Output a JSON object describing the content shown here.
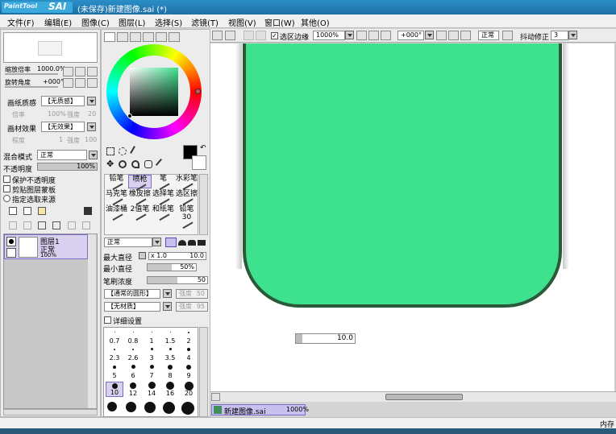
{
  "window": {
    "logo_text": "PaintTool",
    "logo_sai": "SAI",
    "title": "(未保存)新建图像.sai (*)"
  },
  "menu": [
    "文件(F)",
    "编辑(E)",
    "图像(C)",
    "图层(L)",
    "选择(S)",
    "滤镜(T)",
    "视图(V)",
    "窗口(W)",
    "其他(O)"
  ],
  "navigator": {
    "zoom_label": "缩放倍率",
    "zoom_value": "1000.0%",
    "rotate_label": "旋转角度",
    "rotate_value": "+000°"
  },
  "texture": {
    "paper_label": "画纸质感",
    "paper_value": "【无质感】",
    "rate_label": "倍率",
    "rate_value": "100%",
    "strength_label": "强度",
    "strength_value": "20",
    "effect_label": "画材效果",
    "effect_value": "【无效果】",
    "degree_label": "程度",
    "degree_value": "1",
    "effect_strength_label": "强度",
    "effect_strength_value": "100"
  },
  "layer_props": {
    "blend_label": "混合模式",
    "blend_value": "正常",
    "opacity_label": "不透明度",
    "opacity_value": "100%",
    "opacity_fraction": 1.0,
    "preserve_label": "保护不透明度",
    "clip_label": "剪贴图层蒙板",
    "source_label": "指定选取来源"
  },
  "layer": {
    "name": "图层1",
    "mode": "正常",
    "opacity": "100%"
  },
  "color": {
    "current": "#000000",
    "secondary": "#ffffff"
  },
  "tools": [
    "铅笔",
    "喷枪",
    "笔",
    "水彩笔",
    "马克笔",
    "橡皮擦",
    "选择笔",
    "选区擦",
    "油漆桶",
    "2值笔",
    "和纸笔",
    "铅笔30"
  ],
  "brush": {
    "mode_value": "正常",
    "max_size_label": "最大直径",
    "max_size_mult": "x 1.0",
    "max_size_value": "10.0",
    "min_size_label": "最小直径",
    "min_size_value": "50%",
    "min_size_fraction": 0.5,
    "density_label": "笔刷浓度",
    "density_value": "50",
    "density_fraction": 0.5,
    "shape_value": "【通常的圆形】",
    "shape_strength_label": "强度",
    "shape_strength_value": "50",
    "texture_value": "【无材质】",
    "texture_strength_label": "强度",
    "texture_strength_value": "95",
    "detail_label": "详细设置"
  },
  "brush_sizes": [
    "0.7",
    "0.8",
    "1",
    "1.5",
    "2",
    "2.3",
    "2.6",
    "3",
    "3.5",
    "4",
    "5",
    "6",
    "7",
    "8",
    "9",
    "10",
    "12",
    "14",
    "16",
    "20"
  ],
  "canvas_toolbar": {
    "selection_edge_label": "选区边缘",
    "zoom_value": "1000%",
    "rotate_value": "+000°",
    "mode_value": "正常",
    "stabilizer_label": "抖动修正",
    "stabilizer_value": "3"
  },
  "canvas": {
    "fill_color": "#3ee28e",
    "edge_color": "#2a5a3a",
    "bg_color": "#ffffff",
    "brush_size_readout": "10.0"
  },
  "doc_tabs": [
    {
      "name": "新建图像.sai",
      "zoom": "1000%"
    }
  ],
  "status": {
    "memory_label": "内存"
  }
}
